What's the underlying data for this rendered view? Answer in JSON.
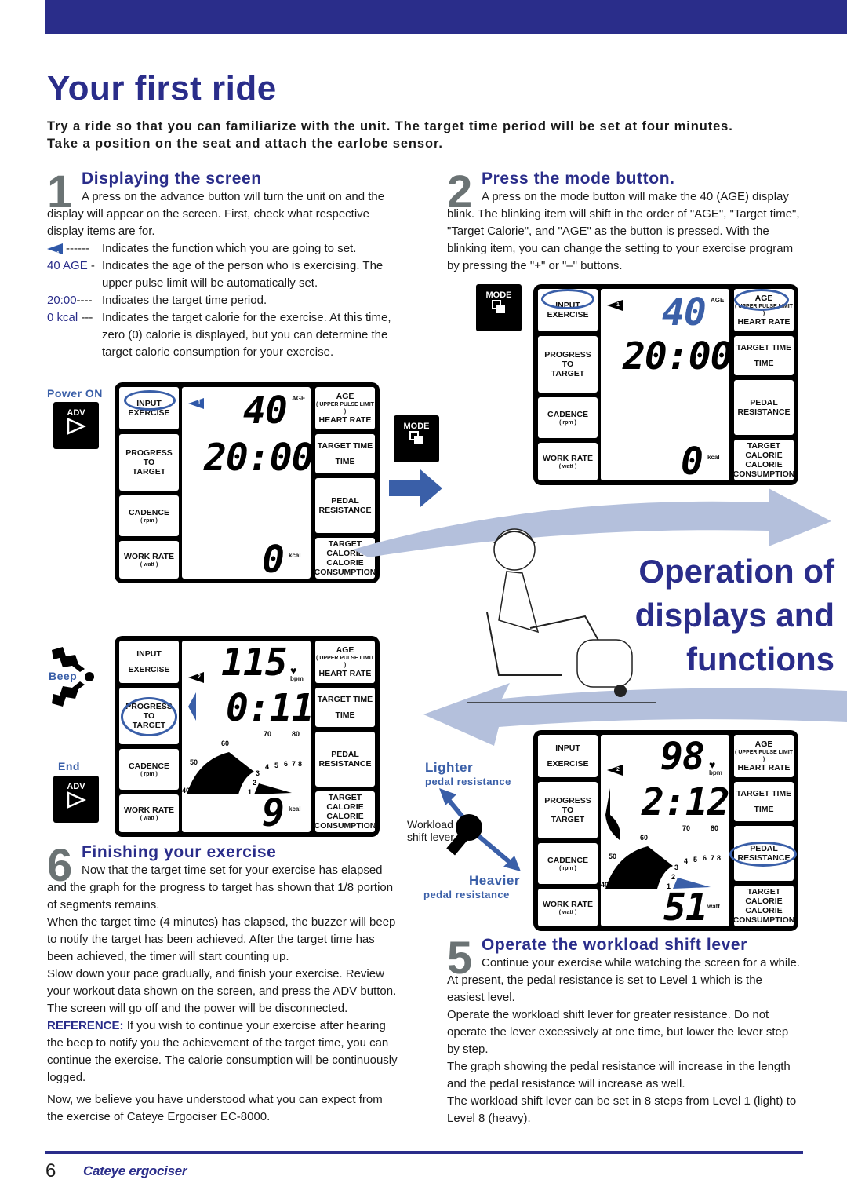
{
  "page": {
    "title": "Your first ride",
    "intro": "Try a ride so that you can familiarize with the unit. The target time period will be set at four minutes. Take a position on the seat and attach the earlobe sensor.",
    "side_heading": [
      "Operation of",
      "displays and",
      "functions"
    ],
    "page_number": "6",
    "brand_logo": "Cateye ergociser"
  },
  "colors": {
    "brand_blue": "#2a2d8a",
    "accent_blue": "#3a5fa8",
    "arrow_light": "#b4c0dc",
    "step_number_gray": "#6b7374"
  },
  "steps": {
    "s1": {
      "number": "1",
      "title": "Displaying the screen",
      "text": "A press on the advance button will turn the unit on and the display will appear on the screen. First, check what respective display items are for.",
      "legend": [
        {
          "key": "1",
          "dash": "------",
          "text": "Indicates the function which you are going to set."
        },
        {
          "key": "40 AGE",
          "dash": "-",
          "text": "Indicates the age of the person who is exercising. The upper pulse limit will be automatically set."
        },
        {
          "key": "20:00",
          "dash": "----",
          "text": "Indicates the target time period."
        },
        {
          "key": "0 kcal",
          "dash": "---",
          "text": "Indicates the target calorie for the exercise. At this time, zero (0) calorie is displayed, but you can determine the target calorie consumption for your exercise."
        }
      ]
    },
    "s2": {
      "number": "2",
      "title": "Press the mode button.",
      "text": "A press on the mode button will make the 40 (AGE) display blink. The blinking item will shift in the order of \"AGE\", \"Target time\", \"Target Calorie\", and \"AGE\" as the button is pressed. With the blinking item, you can change the setting to your exercise program  by pressing the \"+\" or \"–\" buttons."
    },
    "s5": {
      "number": "5",
      "title": "Operate the workload shift lever",
      "text": "Continue your exercise while watching the screen for a while.",
      "paras": [
        "At present, the pedal resistance is set to Level 1 which is the easiest level.",
        "Operate the workload shift lever for greater resistance.  Do not operate the lever excessively at one time, but lower the lever step by step.",
        "The graph showing the pedal resistance will increase in the length and the pedal resistance will increase as well.",
        "The workload shift lever can be set in 8 steps from Level 1 (light) to Level 8 (heavy)."
      ]
    },
    "s6": {
      "number": "6",
      "title": "Finishing your exercise",
      "text": "Now that the target time set for your exercise has elapsed and the graph for the progress to target has shown that 1/8 portion of segments remains.",
      "paras": [
        "When the target time (4 minutes) has elapsed, the buzzer will beep to notify the target has been achieved.  After the target time has been achieved, the timer will start counting up.",
        "Slow down your pace gradually, and finish your exercise. Review your workout data shown on the screen, and press the ADV button. The screen will go off and the power will be disconnected."
      ],
      "reference_label": "REFERENCE:",
      "reference_text": "If you wish to continue your exercise after hearing the beep to notify you the achievement of the target time, you can continue the exercise.  The calorie consumption will be continuously logged.",
      "closing": "Now, we believe you have understood what you can expect from the exercise of Cateye Ergociser EC-8000."
    }
  },
  "labels": {
    "power_on": "Power ON",
    "end": "End",
    "beep": "Beep",
    "adv": "ADV",
    "mode": "MODE",
    "lighter": "Lighter",
    "heavier": "Heavier",
    "pedal_resistance": "pedal resistance",
    "lever_1": "Workload",
    "lever_2": "shift lever"
  },
  "lcd_labels": {
    "input": "INPUT",
    "exercise": "EXERCISE",
    "progress": "PROGRESS",
    "to": "TO",
    "target": "TARGET",
    "cadence": "CADENCE",
    "rpm": "( rpm )",
    "work_rate": "WORK RATE",
    "watt": "( watt )",
    "age": "AGE",
    "upper_pulse": "( UPPER PULSE LIMIT )",
    "heart_rate": "HEART RATE",
    "target_time": "TARGET TIME",
    "time": "TIME",
    "pedal": "PEDAL",
    "resistance": "RESISTANCE",
    "target_calorie_1": "TARGET",
    "target_calorie_2": "CALORIE",
    "calorie": "CALORIE",
    "consumption": "CONSUMPTION"
  },
  "displays": {
    "d1": {
      "top": "40",
      "top_unit": "AGE",
      "mid": "20:00",
      "bottom": "0",
      "bottom_unit": "kcal",
      "indicator": "1"
    },
    "d2": {
      "top": "40",
      "top_unit": "AGE",
      "mid": "20:00",
      "bottom": "0",
      "bottom_unit": "kcal",
      "indicator": "1"
    },
    "d6": {
      "top": "115",
      "top_unit": "bpm",
      "mid": "0:11",
      "bottom": "9",
      "bottom_unit": "kcal",
      "indicator": "2",
      "cadence_ticks": [
        "40",
        "50",
        "60",
        "70",
        "80"
      ],
      "cadence_unit": "rpm",
      "resistance_ticks": [
        "1",
        "2",
        "3",
        "4",
        "5",
        "6",
        "7",
        "8"
      ]
    },
    "d5": {
      "top": "98",
      "top_unit": "bpm",
      "mid": "2:12",
      "bottom": "51",
      "bottom_unit": "watt",
      "indicator": "2",
      "cadence_ticks": [
        "40",
        "50",
        "60",
        "70",
        "80"
      ],
      "cadence_unit": "rpm",
      "resistance_ticks": [
        "1",
        "2",
        "3",
        "4",
        "5",
        "6",
        "7",
        "8"
      ],
      "resistance_level": 3
    }
  }
}
